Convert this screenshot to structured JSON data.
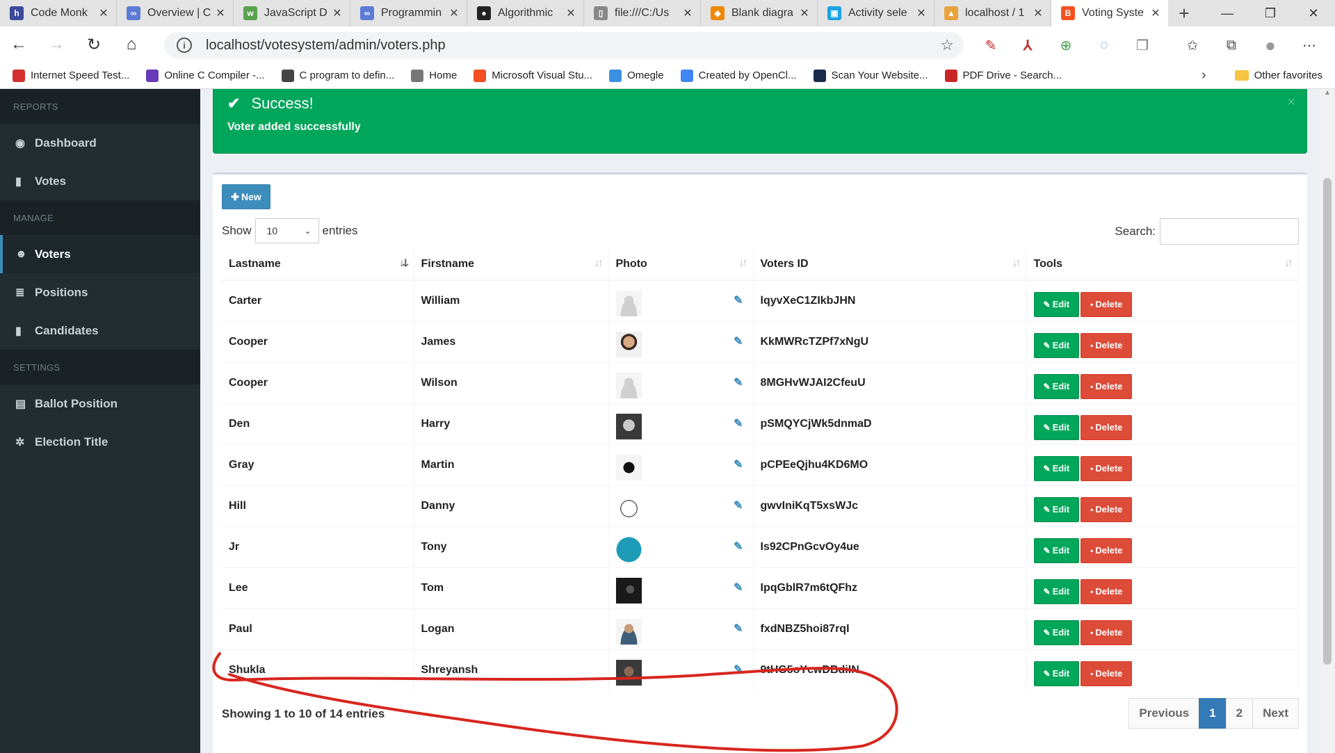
{
  "browser": {
    "tabs": [
      {
        "title": "Code Monk",
        "icon": "h-icon",
        "color": "#3b4a9c",
        "glyph": "h"
      },
      {
        "title": "Overview | C",
        "icon": "infinity-icon",
        "color": "#5b7bd5",
        "glyph": "∞"
      },
      {
        "title": "JavaScript D",
        "icon": "w3-icon",
        "color": "#59a14f",
        "glyph": "w"
      },
      {
        "title": "Programmin",
        "icon": "infinity-icon",
        "color": "#5b7bd5",
        "glyph": "∞"
      },
      {
        "title": "Algorithmic",
        "icon": "github-icon",
        "color": "#222222",
        "glyph": "●"
      },
      {
        "title": "file:///C:/Us",
        "icon": "file-icon",
        "color": "#888888",
        "glyph": "▯"
      },
      {
        "title": "Blank diagra",
        "icon": "diagram-icon",
        "color": "#f08705",
        "glyph": "◆"
      },
      {
        "title": "Activity sele",
        "icon": "app-icon",
        "color": "#1ba1e2",
        "glyph": "▣"
      },
      {
        "title": "localhost / 1",
        "icon": "pma-icon",
        "color": "#e8a33c",
        "glyph": "▲"
      },
      {
        "title": "Voting Syste",
        "icon": "blogger-icon",
        "color": "#f4511e",
        "glyph": "B"
      }
    ],
    "url": "localhost/votesystem/admin/voters.php",
    "bookmarks": [
      {
        "label": "Internet Speed Test...",
        "icon": "speed-icon",
        "color": "#d32f2f"
      },
      {
        "label": "Online C Compiler -...",
        "icon": "compiler-icon",
        "color": "#673ab7"
      },
      {
        "label": "C program to defin...",
        "icon": "c-icon",
        "color": "#444444"
      },
      {
        "label": "Home",
        "icon": "page-icon",
        "color": "#777777"
      },
      {
        "label": "Microsoft Visual Stu...",
        "icon": "microsoft-icon",
        "color": "#f25022"
      },
      {
        "label": "Omegle",
        "icon": "omegle-icon",
        "color": "#3b8fe0"
      },
      {
        "label": "Created by OpenCl...",
        "icon": "google-icon",
        "color": "#4285f4"
      },
      {
        "label": "Scan Your Website...",
        "icon": "scan-icon",
        "color": "#1a2b4c"
      },
      {
        "label": "PDF Drive - Search...",
        "icon": "pdfdrive-icon",
        "color": "#c62828"
      }
    ],
    "other_favorites": "Other favorites"
  },
  "sidebar": {
    "sections": [
      {
        "header": "REPORTS",
        "items": [
          {
            "label": "Dashboard",
            "icon": "dashboard-icon",
            "glyph": "◉",
            "active": false
          },
          {
            "label": "Votes",
            "icon": "lock-icon",
            "glyph": "▮",
            "active": false
          }
        ]
      },
      {
        "header": "MANAGE",
        "items": [
          {
            "label": "Voters",
            "icon": "users-icon",
            "glyph": "☻",
            "active": true
          },
          {
            "label": "Positions",
            "icon": "tasks-icon",
            "glyph": "≣",
            "active": false
          },
          {
            "label": "Candidates",
            "icon": "id-card-icon",
            "glyph": "▮",
            "active": false
          }
        ]
      },
      {
        "header": "SETTINGS",
        "items": [
          {
            "label": "Ballot Position",
            "icon": "file-text-icon",
            "glyph": "▤",
            "active": false
          },
          {
            "label": "Election Title",
            "icon": "cog-icon",
            "glyph": "✲",
            "active": false
          }
        ]
      }
    ]
  },
  "alert": {
    "title": "Success!",
    "message": "Voter added successfully",
    "close": "×"
  },
  "toolbar": {
    "new_label": "New"
  },
  "datatable": {
    "show_label": "Show",
    "entries_label": "entries",
    "page_length": "10",
    "search_label": "Search:",
    "columns": [
      "Lastname",
      "Firstname",
      "Photo",
      "Voters ID",
      "Tools"
    ],
    "edit_label": "Edit",
    "delete_label": "Delete",
    "rows": [
      {
        "lastname": "Carter",
        "firstname": "William",
        "photo": "default-avatar",
        "voters_id": "lqyvXeC1ZIkbJHN"
      },
      {
        "lastname": "Cooper",
        "firstname": "James",
        "photo": "man-photo",
        "voters_id": "KkMWRcTZPf7xNgU"
      },
      {
        "lastname": "Cooper",
        "firstname": "Wilson",
        "photo": "default-avatar",
        "voters_id": "8MGHvWJAI2CfeuU"
      },
      {
        "lastname": "Den",
        "firstname": "Harry",
        "photo": "helmet-photo",
        "voters_id": "pSMQYCjWk5dnmaD"
      },
      {
        "lastname": "Gray",
        "firstname": "Martin",
        "photo": "mask-photo",
        "voters_id": "pCPEeQjhu4KD6MO"
      },
      {
        "lastname": "Hill",
        "firstname": "Danny",
        "photo": "trollface-photo",
        "voters_id": "gwvIniKqT5xsWJc"
      },
      {
        "lastname": "Jr",
        "firstname": "Tony",
        "photo": "palm-logo-photo",
        "voters_id": "Is92CPnGcvOy4ue"
      },
      {
        "lastname": "Lee",
        "firstname": "Tom",
        "photo": "dark-photo",
        "voters_id": "IpqGblR7m6tQFhz"
      },
      {
        "lastname": "Paul",
        "firstname": "Logan",
        "photo": "bearded-man-photo",
        "voters_id": "fxdNBZ5hoi87rqI"
      },
      {
        "lastname": "Shukla",
        "firstname": "Shreyansh",
        "photo": "person-photo",
        "voters_id": "9tHG5oYcwDBdiIN"
      }
    ],
    "info": "Showing 1 to 10 of 14 entries",
    "pagination": [
      "Previous",
      "1",
      "2",
      "Next"
    ],
    "current_page": "1"
  },
  "colors": {
    "success": "#00a65a",
    "danger": "#dd4b39",
    "primary": "#3c8dbc",
    "sidebar": "#222d32",
    "annotation": "#d7261e"
  }
}
